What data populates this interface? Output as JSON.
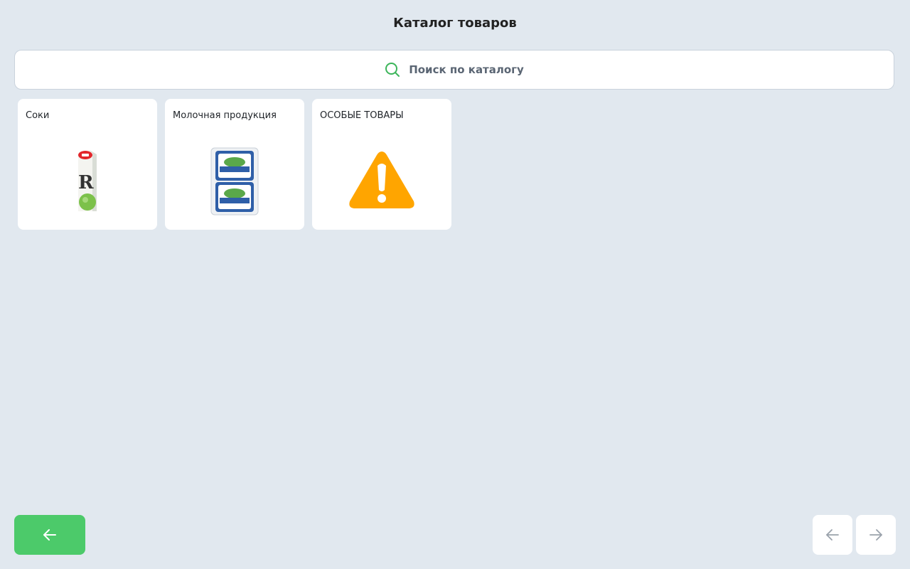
{
  "header": {
    "title": "Каталог товаров"
  },
  "search": {
    "placeholder": "Поиск по каталогу",
    "icon": "search-icon",
    "icon_color": "#3cb55a"
  },
  "categories": [
    {
      "label": "Соки",
      "icon": "juice-carton-image"
    },
    {
      "label": "Молочная продукция",
      "icon": "milk-package-image"
    },
    {
      "label": "ОСОБЫЕ ТОВАРЫ",
      "icon": "warning-icon",
      "icon_color": "#ffa500"
    }
  ],
  "navigation": {
    "back_icon": "arrow-left-icon",
    "back_color": "#4cca6a",
    "prev_icon": "arrow-left-icon",
    "next_icon": "arrow-right-icon"
  }
}
